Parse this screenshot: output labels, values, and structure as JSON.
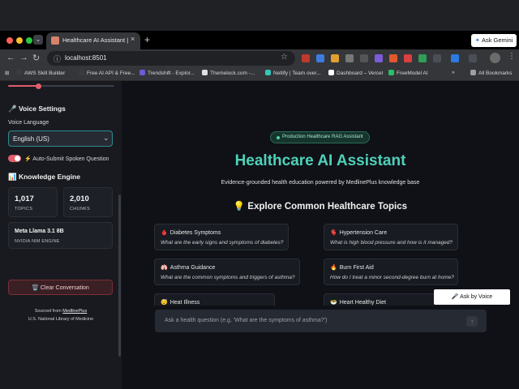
{
  "browser": {
    "tab_title": "Healthcare AI Assistant | Medi",
    "tab_close": "×",
    "tab_list": "⌄",
    "new_tab": "+",
    "ask_gemini": "Ask Gemini",
    "url": "localhost:8501",
    "bookmarks": [
      {
        "label": "AWS Skill Builder",
        "color": "#3b3b3b"
      },
      {
        "label": "Free AI API & Free...",
        "color": "#3b3b3b"
      },
      {
        "label": "Trendshift - Explor...",
        "color": "#6b5bd6"
      },
      {
        "label": "Themelock.com -...",
        "color": "#e0e0e0"
      },
      {
        "label": "Netlify | Team over...",
        "color": "#36c5b7"
      },
      {
        "label": "Dashboard – Vercel",
        "color": "#ffffff"
      },
      {
        "label": "FreeModel AI",
        "color": "#2bbf6a"
      }
    ],
    "bookmarks_more": "»",
    "all_bookmarks": "All Bookmarks"
  },
  "sidebar": {
    "voice_settings_heading": "🎤 Voice Settings",
    "voice_language_label": "Voice Language",
    "voice_language_value": "English (US)",
    "auto_submit_label": "⚡ Auto-Submit Spoken Question",
    "auto_submit_on": true,
    "knowledge_heading": "📊 Knowledge Engine",
    "stats": [
      {
        "value": "1,017",
        "label": "TOPICS"
      },
      {
        "value": "2,010",
        "label": "CHUNKS"
      }
    ],
    "model_name": "Meta Llama 3.1 8B",
    "model_engine": "NVIDIA NIM ENGINE",
    "clear_button": "🗑️ Clear Conversation",
    "source_prefix": "Sourced from ",
    "source_link": "MedlinePlus",
    "source_org": "U.S. National Library of Medicine"
  },
  "main": {
    "badge": "Production Healthcare RAG Assistant",
    "title": "Healthcare AI Assistant",
    "subtitle": "Evidence-grounded health education powered by MedlinePlus knowledge base",
    "explore_heading": "💡 Explore Common Healthcare Topics",
    "topics": [
      {
        "icon": "🩸",
        "title": "Diabetes Symptoms",
        "question": "What are the early signs and symptoms of diabetes?"
      },
      {
        "icon": "🫀",
        "title": "Hypertension Care",
        "question": "What is high blood pressure and how is it managed?"
      },
      {
        "icon": "🫁",
        "title": "Asthma Guidance",
        "question": "What are the common symptoms and triggers of asthma?"
      },
      {
        "icon": "🔥",
        "title": "Burn First Aid",
        "question": "How do I treat a minor second-degree burn at home?"
      },
      {
        "icon": "😴",
        "title": "Heat Illness",
        "question": ""
      },
      {
        "icon": "🥗",
        "title": "Heart Healthy Diet",
        "question": ""
      }
    ],
    "ask_voice": "🎤 Ask by Voice",
    "chat_placeholder": "Ask a health question (e.g. 'What are the symptoms of asthma?')",
    "send_icon": "↑"
  }
}
